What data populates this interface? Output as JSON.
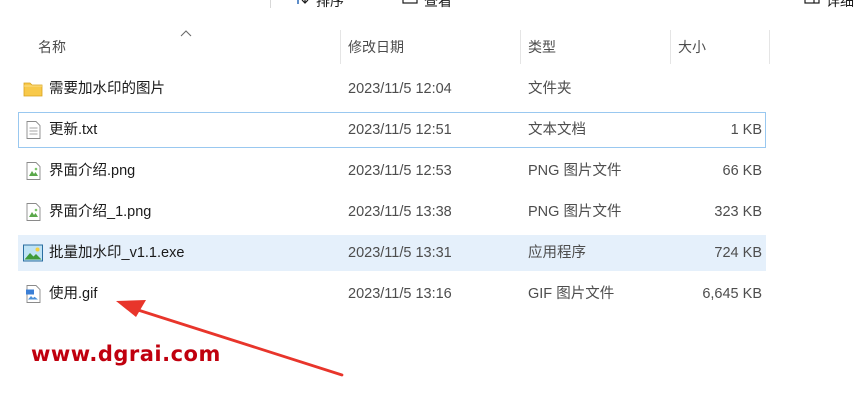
{
  "toolbar": {
    "sort_label": "排序",
    "view_label": "查看",
    "details_label": "详细"
  },
  "columns": {
    "name": "名称",
    "modified": "修改日期",
    "type": "类型",
    "size": "大小"
  },
  "files": [
    {
      "name": "需要加水印的图片",
      "modified": "2023/11/5 12:04",
      "type": "文件夹",
      "size": "",
      "icon": "folder-icon"
    },
    {
      "name": "更新.txt",
      "modified": "2023/11/5 12:51",
      "type": "文本文档",
      "size": "1 KB",
      "icon": "text-file-icon"
    },
    {
      "name": "界面介绍.png",
      "modified": "2023/11/5 12:53",
      "type": "PNG 图片文件",
      "size": "66 KB",
      "icon": "image-file-icon"
    },
    {
      "name": "界面介绍_1.png",
      "modified": "2023/11/5 13:38",
      "type": "PNG 图片文件",
      "size": "323 KB",
      "icon": "image-file-icon"
    },
    {
      "name": "批量加水印_v1.1.exe",
      "modified": "2023/11/5 13:31",
      "type": "应用程序",
      "size": "724 KB",
      "icon": "exe-app-icon"
    },
    {
      "name": "使用.gif",
      "modified": "2023/11/5 13:16",
      "type": "GIF 图片文件",
      "size": "6,645 KB",
      "icon": "gif-file-icon"
    }
  ],
  "watermark": "www.dgrai.com",
  "colors": {
    "selection": "#e5f0fb",
    "focus_outline": "#99c8f0",
    "folder": "#f8c94a",
    "arrow": "#e8352b",
    "watermark": "#c0000e"
  }
}
